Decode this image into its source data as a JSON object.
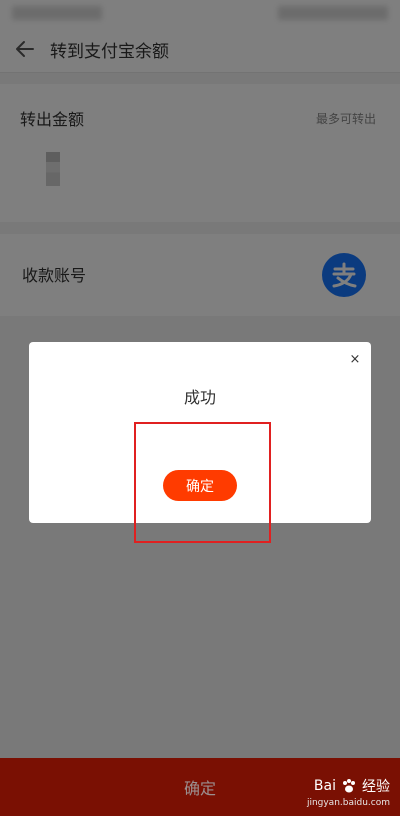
{
  "header": {
    "title": "转到支付宝余额"
  },
  "amount": {
    "label": "转出金额",
    "hint": "最多可转出"
  },
  "account": {
    "label": "收款账号"
  },
  "dialog": {
    "close_symbol": "×",
    "title": "成功",
    "confirm_label": "确定"
  },
  "bottom_bar": {
    "confirm_label": "确定"
  },
  "watermark": {
    "brand": "Bai",
    "brand_suffix": "经验",
    "url": "jingyan.baidu.com"
  },
  "colors": {
    "accent": "#ff3b00",
    "alipay_blue": "#1677ff",
    "highlight": "#e02020",
    "bottom_bar": "#7a1003"
  }
}
